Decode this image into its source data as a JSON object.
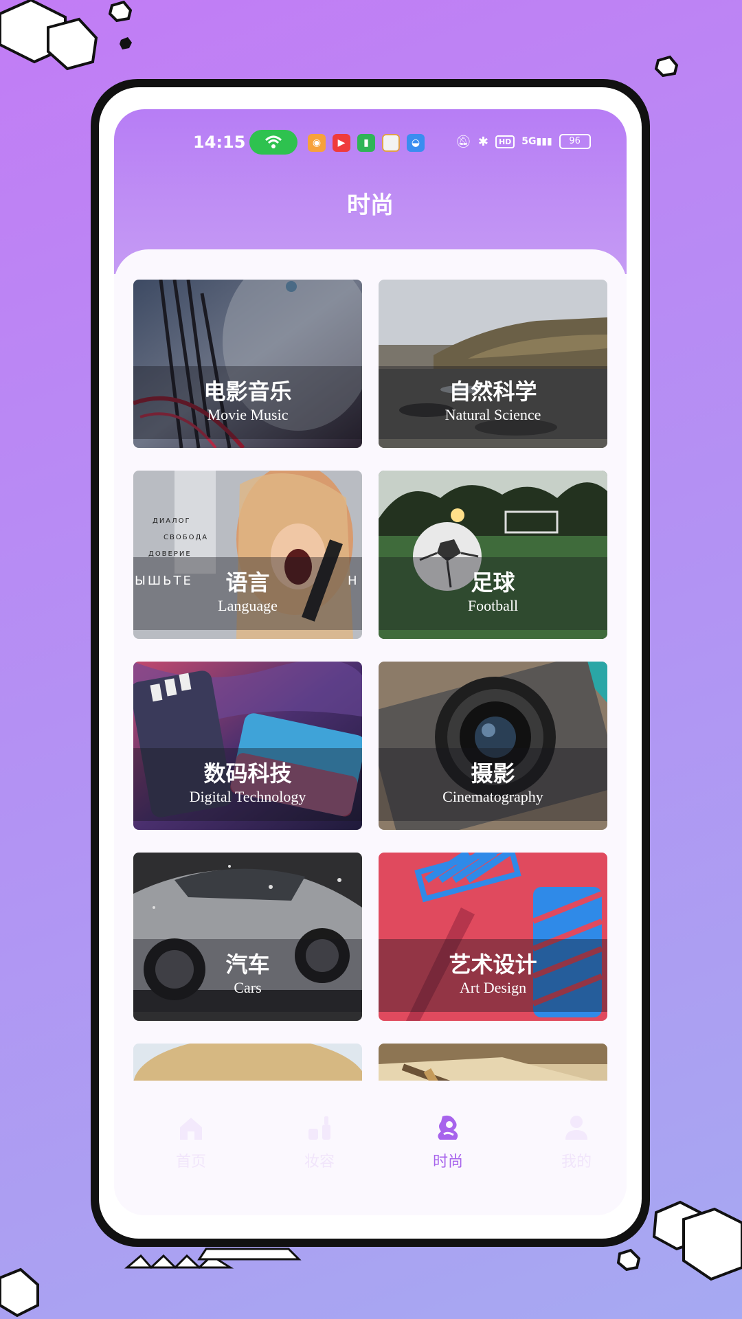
{
  "status_bar": {
    "time": "14:15",
    "battery": "96",
    "hd": "HD",
    "network": "5G",
    "app_icons": [
      "weibo-icon",
      "video-icon",
      "battery-app-icon",
      "wallet-icon",
      "android-icon"
    ]
  },
  "header": {
    "title": "时尚"
  },
  "categories": [
    {
      "cn": "电影音乐",
      "en": "Movie Music",
      "theme": "movie"
    },
    {
      "cn": "自然科学",
      "en": "Natural Science",
      "theme": "nature"
    },
    {
      "cn": "语言",
      "en": "Language",
      "theme": "language"
    },
    {
      "cn": "足球",
      "en": "Football",
      "theme": "football"
    },
    {
      "cn": "数码科技",
      "en": "Digital Technology",
      "theme": "tech"
    },
    {
      "cn": "摄影",
      "en": "Cinematography",
      "theme": "camera"
    },
    {
      "cn": "汽车",
      "en": "Cars",
      "theme": "cars"
    },
    {
      "cn": "艺术设计",
      "en": "Art Design",
      "theme": "art"
    }
  ],
  "language_card_text": {
    "line1": "ДИАЛОГ",
    "line2": "СВОБОДА",
    "line3": "ДОВЕРИЕ",
    "left": "ЫШЬТЕ",
    "right": "Н"
  },
  "tabbar": {
    "items": [
      {
        "label": "首页",
        "icon": "home-icon",
        "active": false
      },
      {
        "label": "妆容",
        "icon": "makeup-icon",
        "active": false
      },
      {
        "label": "时尚",
        "icon": "fashion-icon",
        "active": true
      },
      {
        "label": "我的",
        "icon": "user-icon",
        "active": false
      }
    ]
  },
  "colors": {
    "accent": "#a763ec",
    "header_top": "#b77df5",
    "background_top": "#c27cf5",
    "background_bottom": "#a6a9f2"
  }
}
